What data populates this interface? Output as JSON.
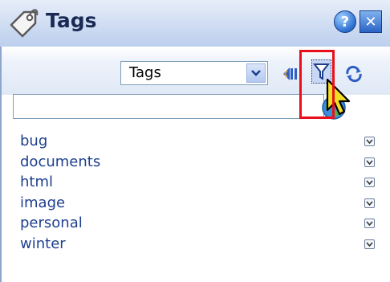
{
  "window": {
    "title": "Tags",
    "icon": "tag-icon",
    "help_icon": "help-icon",
    "help_symbol": "?",
    "close_icon": "close-icon",
    "close_symbol": "✕"
  },
  "toolbar": {
    "view_select": {
      "selected": "Tags"
    },
    "icons": [
      "back-icon",
      "filter-icon",
      "refresh-icon"
    ],
    "highlight_color": "#e8101a"
  },
  "search": {
    "value": "",
    "placeholder": "",
    "go_icon": "globe-search-icon"
  },
  "tags": [
    {
      "label": "bug"
    },
    {
      "label": "documents"
    },
    {
      "label": "html"
    },
    {
      "label": "image"
    },
    {
      "label": "personal"
    },
    {
      "label": "winter"
    }
  ],
  "colors": {
    "link": "#1f3f8f",
    "title_text": "#1b2a55",
    "titlebar": "#cfdcf2",
    "accent_blue": "#2c63c4"
  }
}
